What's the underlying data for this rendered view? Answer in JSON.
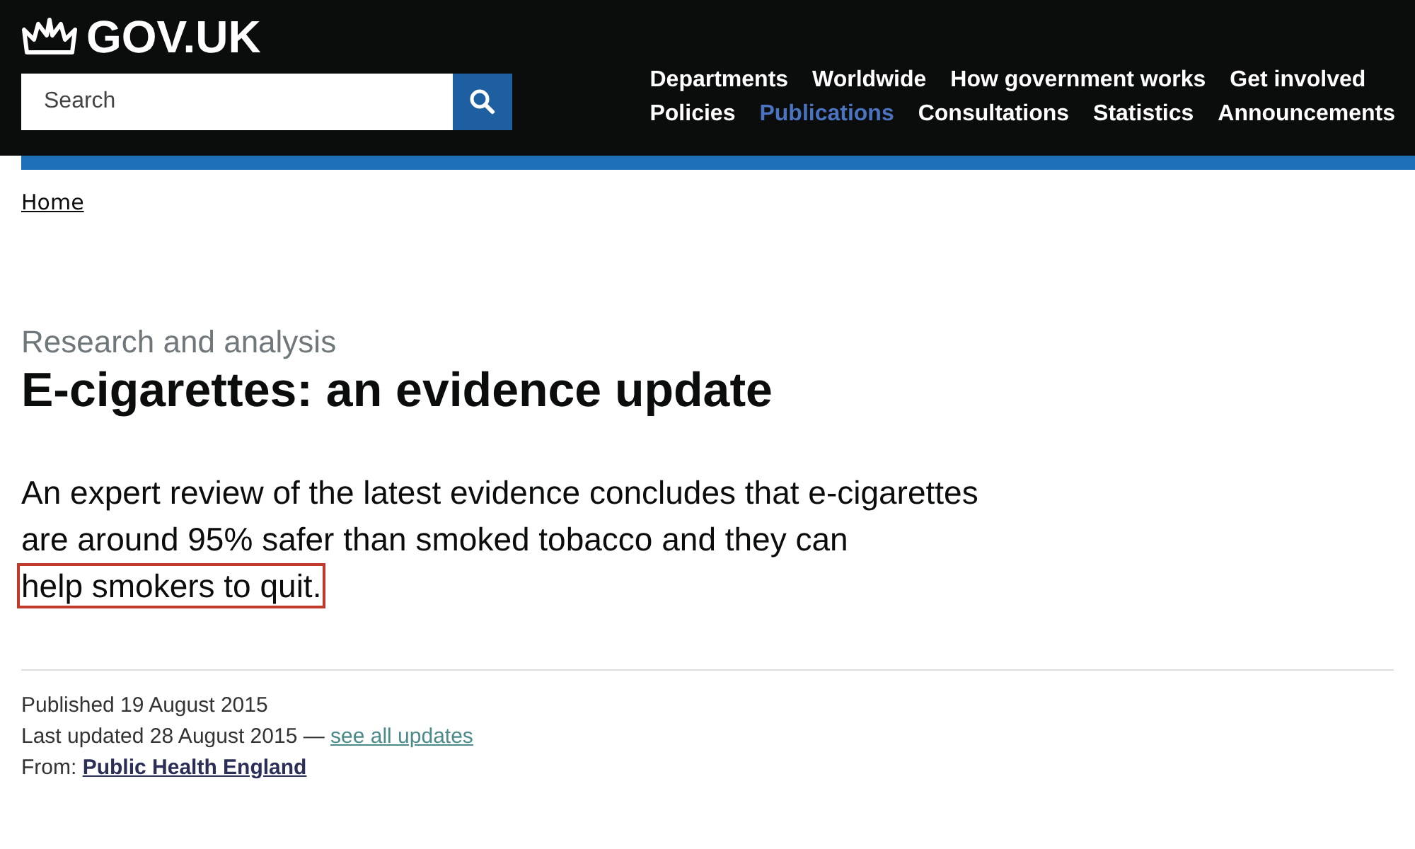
{
  "header": {
    "logo": "GOV.UK",
    "search": {
      "placeholder": "Search"
    },
    "nav_rows": [
      {
        "items": [
          {
            "label": "Departments",
            "selected": false
          },
          {
            "label": "Worldwide",
            "selected": false
          },
          {
            "label": "How government works",
            "selected": false
          },
          {
            "label": "Get involved",
            "selected": false
          }
        ]
      },
      {
        "items": [
          {
            "label": "Policies",
            "selected": false
          },
          {
            "label": "Publications",
            "selected": true
          },
          {
            "label": "Consultations",
            "selected": false
          },
          {
            "label": "Statistics",
            "selected": false
          },
          {
            "label": "Announcements",
            "selected": false
          }
        ]
      }
    ]
  },
  "breadcrumbs": [
    "Home"
  ],
  "document_type": "Research and analysis",
  "title": "E-cigarettes: an evidence update",
  "summary": [
    {
      "text": "An expert review of the latest evidence concludes that e-cigarettes are around 95% safer than smoked tobacco and they can",
      "highlighted": false
    },
    {
      "text": "help smokers to quit.",
      "highlighted": true
    }
  ],
  "metadata": {
    "published": "Published 19 August 2015",
    "updated": "Last updated 28 August 2015 —",
    "updates_link": "see all updates",
    "from_label": "From:",
    "from_link": "Public Health England"
  }
}
